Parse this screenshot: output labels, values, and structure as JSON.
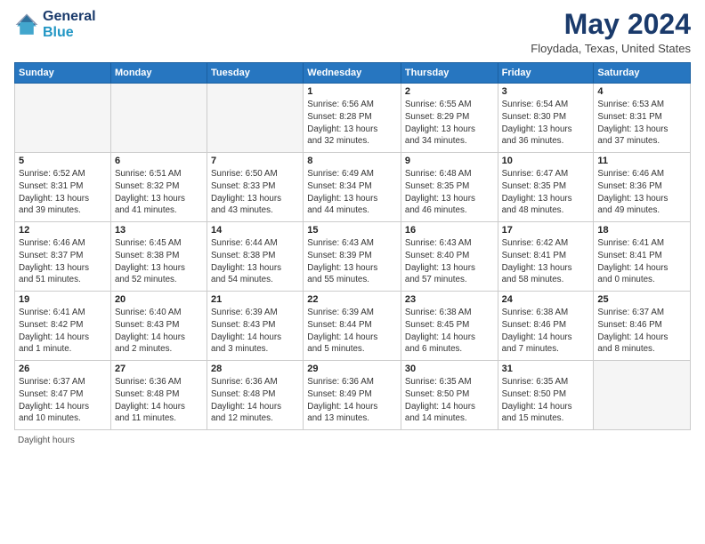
{
  "header": {
    "logo_line1": "General",
    "logo_line2": "Blue",
    "month_title": "May 2024",
    "location": "Floydada, Texas, United States"
  },
  "days_of_week": [
    "Sunday",
    "Monday",
    "Tuesday",
    "Wednesday",
    "Thursday",
    "Friday",
    "Saturday"
  ],
  "footer": {
    "note": "Daylight hours"
  },
  "weeks": [
    {
      "days": [
        {
          "num": "",
          "info": ""
        },
        {
          "num": "",
          "info": ""
        },
        {
          "num": "",
          "info": ""
        },
        {
          "num": "1",
          "info": "Sunrise: 6:56 AM\nSunset: 8:28 PM\nDaylight: 13 hours\nand 32 minutes."
        },
        {
          "num": "2",
          "info": "Sunrise: 6:55 AM\nSunset: 8:29 PM\nDaylight: 13 hours\nand 34 minutes."
        },
        {
          "num": "3",
          "info": "Sunrise: 6:54 AM\nSunset: 8:30 PM\nDaylight: 13 hours\nand 36 minutes."
        },
        {
          "num": "4",
          "info": "Sunrise: 6:53 AM\nSunset: 8:31 PM\nDaylight: 13 hours\nand 37 minutes."
        }
      ]
    },
    {
      "days": [
        {
          "num": "5",
          "info": "Sunrise: 6:52 AM\nSunset: 8:31 PM\nDaylight: 13 hours\nand 39 minutes."
        },
        {
          "num": "6",
          "info": "Sunrise: 6:51 AM\nSunset: 8:32 PM\nDaylight: 13 hours\nand 41 minutes."
        },
        {
          "num": "7",
          "info": "Sunrise: 6:50 AM\nSunset: 8:33 PM\nDaylight: 13 hours\nand 43 minutes."
        },
        {
          "num": "8",
          "info": "Sunrise: 6:49 AM\nSunset: 8:34 PM\nDaylight: 13 hours\nand 44 minutes."
        },
        {
          "num": "9",
          "info": "Sunrise: 6:48 AM\nSunset: 8:35 PM\nDaylight: 13 hours\nand 46 minutes."
        },
        {
          "num": "10",
          "info": "Sunrise: 6:47 AM\nSunset: 8:35 PM\nDaylight: 13 hours\nand 48 minutes."
        },
        {
          "num": "11",
          "info": "Sunrise: 6:46 AM\nSunset: 8:36 PM\nDaylight: 13 hours\nand 49 minutes."
        }
      ]
    },
    {
      "days": [
        {
          "num": "12",
          "info": "Sunrise: 6:46 AM\nSunset: 8:37 PM\nDaylight: 13 hours\nand 51 minutes."
        },
        {
          "num": "13",
          "info": "Sunrise: 6:45 AM\nSunset: 8:38 PM\nDaylight: 13 hours\nand 52 minutes."
        },
        {
          "num": "14",
          "info": "Sunrise: 6:44 AM\nSunset: 8:38 PM\nDaylight: 13 hours\nand 54 minutes."
        },
        {
          "num": "15",
          "info": "Sunrise: 6:43 AM\nSunset: 8:39 PM\nDaylight: 13 hours\nand 55 minutes."
        },
        {
          "num": "16",
          "info": "Sunrise: 6:43 AM\nSunset: 8:40 PM\nDaylight: 13 hours\nand 57 minutes."
        },
        {
          "num": "17",
          "info": "Sunrise: 6:42 AM\nSunset: 8:41 PM\nDaylight: 13 hours\nand 58 minutes."
        },
        {
          "num": "18",
          "info": "Sunrise: 6:41 AM\nSunset: 8:41 PM\nDaylight: 14 hours\nand 0 minutes."
        }
      ]
    },
    {
      "days": [
        {
          "num": "19",
          "info": "Sunrise: 6:41 AM\nSunset: 8:42 PM\nDaylight: 14 hours\nand 1 minute."
        },
        {
          "num": "20",
          "info": "Sunrise: 6:40 AM\nSunset: 8:43 PM\nDaylight: 14 hours\nand 2 minutes."
        },
        {
          "num": "21",
          "info": "Sunrise: 6:39 AM\nSunset: 8:43 PM\nDaylight: 14 hours\nand 3 minutes."
        },
        {
          "num": "22",
          "info": "Sunrise: 6:39 AM\nSunset: 8:44 PM\nDaylight: 14 hours\nand 5 minutes."
        },
        {
          "num": "23",
          "info": "Sunrise: 6:38 AM\nSunset: 8:45 PM\nDaylight: 14 hours\nand 6 minutes."
        },
        {
          "num": "24",
          "info": "Sunrise: 6:38 AM\nSunset: 8:46 PM\nDaylight: 14 hours\nand 7 minutes."
        },
        {
          "num": "25",
          "info": "Sunrise: 6:37 AM\nSunset: 8:46 PM\nDaylight: 14 hours\nand 8 minutes."
        }
      ]
    },
    {
      "days": [
        {
          "num": "26",
          "info": "Sunrise: 6:37 AM\nSunset: 8:47 PM\nDaylight: 14 hours\nand 10 minutes."
        },
        {
          "num": "27",
          "info": "Sunrise: 6:36 AM\nSunset: 8:48 PM\nDaylight: 14 hours\nand 11 minutes."
        },
        {
          "num": "28",
          "info": "Sunrise: 6:36 AM\nSunset: 8:48 PM\nDaylight: 14 hours\nand 12 minutes."
        },
        {
          "num": "29",
          "info": "Sunrise: 6:36 AM\nSunset: 8:49 PM\nDaylight: 14 hours\nand 13 minutes."
        },
        {
          "num": "30",
          "info": "Sunrise: 6:35 AM\nSunset: 8:50 PM\nDaylight: 14 hours\nand 14 minutes."
        },
        {
          "num": "31",
          "info": "Sunrise: 6:35 AM\nSunset: 8:50 PM\nDaylight: 14 hours\nand 15 minutes."
        },
        {
          "num": "",
          "info": ""
        }
      ]
    }
  ]
}
